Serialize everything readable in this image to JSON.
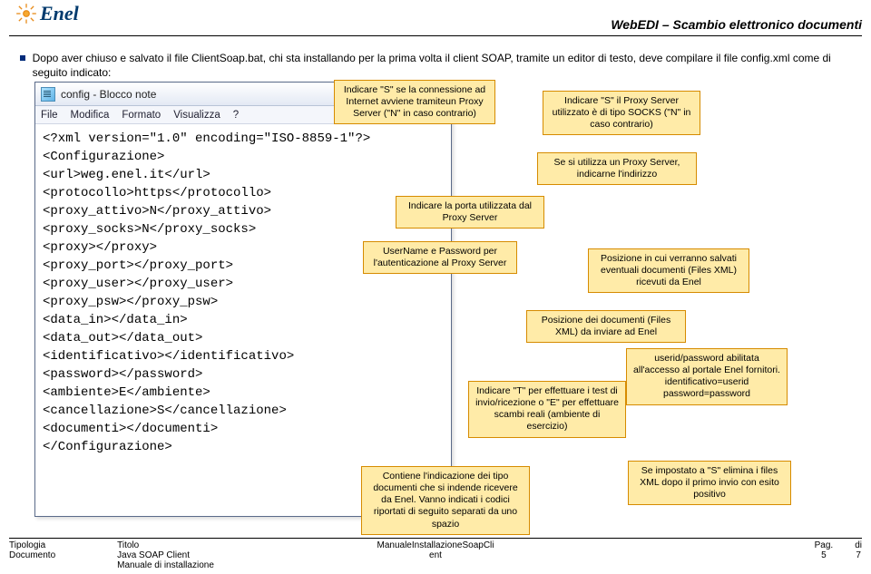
{
  "header": {
    "brand": "Enel",
    "title": "WebEDI – Scambio elettronico documenti"
  },
  "bullet_text": "Dopo aver chiuso e salvato il file ClientSoap.bat, chi sta installando per la prima volta il client SOAP, tramite un editor di testo, deve compilare il file config.xml come di seguito indicato:",
  "notepad": {
    "title": "config - Blocco note",
    "menu": [
      "File",
      "Modifica",
      "Formato",
      "Visualizza",
      "?"
    ],
    "lines": [
      "<?xml version=\"1.0\" encoding=\"ISO-8859-1\"?>",
      "<Configurazione>",
      "<url>weg.enel.it</url>",
      "<protocollo>https</protocollo>",
      "<proxy_attivo>N</proxy_attivo>",
      "<proxy_socks>N</proxy_socks>",
      "<proxy></proxy>",
      "<proxy_port></proxy_port>",
      "<proxy_user></proxy_user>",
      "<proxy_psw></proxy_psw>",
      "<data_in></data_in>",
      "<data_out></data_out>",
      "<identificativo></identificativo>",
      "<password></password>",
      "<ambiente>E</ambiente>",
      "<cancellazione>S</cancellazione>",
      "<documenti></documenti>",
      "</Configurazione>"
    ]
  },
  "callouts": {
    "conn": "Indicare \"S\" se la connessione ad Internet avviene tramiteun Proxy Server (\"N\" in caso contrario)",
    "socks": "Indicare \"S\" il Proxy Server utilizzato è di tipo SOCKS (\"N\" in caso contrario)",
    "proxyaddr": "Se si utilizza un Proxy Server, indicarne l'indirizzo",
    "port": "Indicare la porta utilizzata dal Proxy Server",
    "userpw": "UserName e Password per l'autenticazione al Proxy Server",
    "datain": "Posizione in cui verranno salvati eventuali documenti (Files XML) ricevuti da Enel",
    "dataout": "Posizione dei documenti (Files XML) da inviare ad Enel",
    "userid": "userid/password abilitata all'accesso al portale Enel fornitori. identificativo=userid password=password",
    "ambiente": "Indicare \"T\" per effettuare i test di invio/ricezione o \"E\" per effettuare scambi reali (ambiente di esercizio)",
    "cancel": "Se impostato a \"S\" elimina i files XML dopo il primo invio con esito positivo",
    "docs": "Contiene l'indicazione dei tipo documenti che si indende ricevere da Enel. Vanno indicati i codici riportati di seguito separati da uno spazio"
  },
  "footer": {
    "tipologia_lbl": "Tipologia",
    "tipologia_val": "Documento",
    "titolo_lbl": "Titolo",
    "titolo_val1": "Java SOAP Client",
    "titolo_val2": "Manuale di installazione",
    "center1": "ManualeInstallazioneSoapCli",
    "center2": "ent",
    "pag_lbl": "Pag.",
    "pag_val": "5",
    "di_lbl": "di",
    "di_val": "7"
  }
}
